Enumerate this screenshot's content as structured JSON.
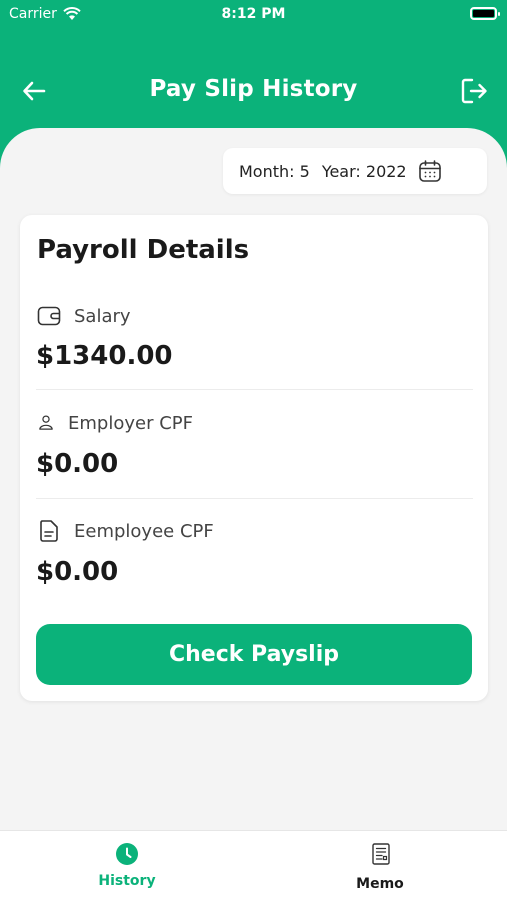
{
  "status_bar": {
    "carrier": "Carrier",
    "time": "8:12 PM"
  },
  "header": {
    "title": "Pay Slip History",
    "back_icon": "arrow-left-icon",
    "logout_icon": "logout-icon"
  },
  "date_filter": {
    "month": "Month: 5",
    "year": "Year: 2022",
    "icon": "calendar-icon"
  },
  "card": {
    "title": "Payroll Details",
    "rows": [
      {
        "label": "Salary",
        "value": "$1340.00",
        "icon": "wallet-icon"
      },
      {
        "label": "Employer CPF",
        "value": "$0.00",
        "icon": "user-icon"
      },
      {
        "label": "Eemployee CPF",
        "value": "$0.00",
        "icon": "document-icon"
      }
    ],
    "button_label": "Check Payslip"
  },
  "tabs": [
    {
      "label": "History",
      "icon": "clock-icon",
      "active": true
    },
    {
      "label": "Memo",
      "icon": "memo-icon",
      "active": false
    }
  ],
  "colors": {
    "brand": "#0bb27a",
    "background": "#f4f4f4",
    "card": "#ffffff"
  }
}
